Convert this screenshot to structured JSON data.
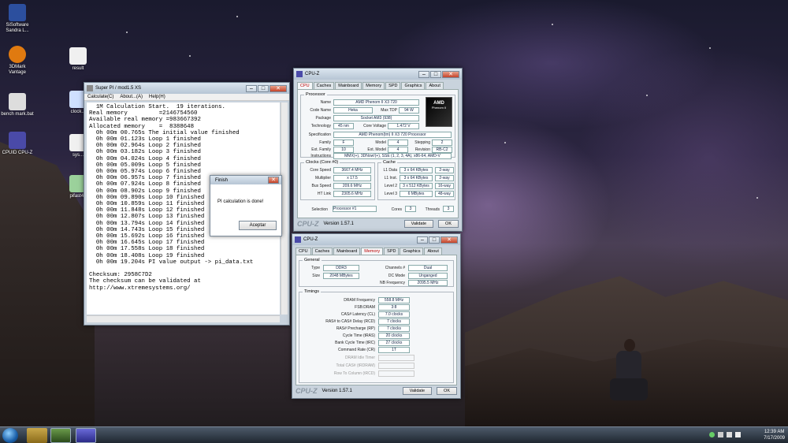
{
  "desktop": {
    "icons": [
      {
        "label": "SiSoftware Sandra L...",
        "color": "#2c4f9e"
      },
      {
        "label": "3DMark Vantage",
        "color": "#e07a10"
      },
      {
        "label": "bench mark.bat",
        "color": "#dddddd"
      },
      {
        "label": "CPUID CPU-Z",
        "color": "#4a4aa8"
      },
      {
        "label": "result",
        "color": "#f0f0f0"
      },
      {
        "label": "clock...",
        "color": "#cfe0ff"
      },
      {
        "label": "sys...",
        "color": "#f0f0f0"
      },
      {
        "label": "pifast41",
        "color": "#9bd19b"
      }
    ]
  },
  "superpi": {
    "title": "Super PI / mod1.5 XS",
    "menu": [
      "Calculate(C)",
      "About...(A)",
      "Help(H)"
    ],
    "console_lines": [
      "  1M Calculation Start.  19 iterations.",
      "Real memory         =2146754560",
      "Available real memory =983667392",
      "Allocated memory    =  8388648",
      "  0h 00m 00.765s The initial value finished",
      "  0h 00m 01.123s Loop 1 finished",
      "  0h 00m 02.964s Loop 2 finished",
      "  0h 00m 03.182s Loop 3 finished",
      "  0h 00m 04.024s Loop 4 finished",
      "  0h 00m 05.009s Loop 5 finished",
      "  0h 00m 05.974s Loop 6 finished",
      "  0h 00m 06.957s Loop 7 finished",
      "  0h 00m 07.924s Loop 8 finished",
      "  0h 00m 08.902s Loop 9 finished",
      "  0h 00m 09.890s Loop 10 finished",
      "  0h 00m 10.859s Loop 11 finished",
      "  0h 00m 11.848s Loop 12 finished",
      "  0h 00m 12.807s Loop 13 finished",
      "  0h 00m 13.794s Loop 14 finished",
      "  0h 00m 14.743s Loop 15 finished",
      "  0h 00m 15.692s Loop 16 finished",
      "  0h 00m 16.645s Loop 17 finished",
      "  0h 00m 17.558s Loop 18 finished",
      "  0h 00m 18.408s Loop 19 finished",
      "  0h 00m 19.204s PI value output -> pi_data.txt",
      "",
      "Checksum: 2958C7D2",
      "The checksum can be validated at",
      "http://www.xtremesystems.org/"
    ]
  },
  "dialog": {
    "title": "Finish",
    "message": "PI calculation is done!",
    "ok_label": "Aceptar"
  },
  "cpuz1": {
    "title": "CPU-Z",
    "tabs": [
      "CPU",
      "Caches",
      "Mainboard",
      "Memory",
      "SPD",
      "Graphics",
      "About"
    ],
    "active_tab": "CPU",
    "processor_group": "Processor",
    "name_label": "Name",
    "name": "AMD Phenom II X3 720",
    "codename_label": "Code Name",
    "codename": "Heka",
    "maxtdp_label": "Max TDP",
    "maxtdp": "94 W",
    "package_label": "Package",
    "package": "Socket AM3 (938)",
    "technology_label": "Technology",
    "technology": "45 nm",
    "corevoltage_label": "Core Voltage",
    "corevoltage": "1.472 V",
    "spec_label": "Specification",
    "spec": "AMD Phenom(tm) II X3 720 Processor",
    "family_label": "Family",
    "family": "F",
    "model_label": "Model",
    "model": "4",
    "stepping_label": "Stepping",
    "stepping": "2",
    "extfamily_label": "Ext. Family",
    "extfamily": "10",
    "extmodel_label": "Ext. Model",
    "extmodel": "4",
    "revision_label": "Revision",
    "revision": "RB-C2",
    "instr_label": "Instructions",
    "instr": "MMX(+), 3DNow!(+), SSE (1, 2, 3, 4A), x86-64, AMD-V",
    "clocks_group": "Clocks (Core #0)",
    "corespeed_label": "Core Speed",
    "corespeed": "3667.4 MHz",
    "multiplier_label": "Multiplier",
    "multiplier": "x 17.5",
    "busspeed_label": "Bus Speed",
    "busspeed": "209.6 MHz",
    "htlink_label": "HT Link",
    "htlink": "2305.6 MHz",
    "cache_group": "Cache",
    "l1d_label": "L1 Data",
    "l1d": "3 x 64 KBytes",
    "l1d_way": "2-way",
    "l1i_label": "L1 Inst.",
    "l1i": "3 x 64 KBytes",
    "l1i_way": "2-way",
    "l2_label": "Level 2",
    "l2": "3 x 512 KBytes",
    "l2_way": "16-way",
    "l3_label": "Level 3",
    "l3": "6 MBytes",
    "l3_way": "48-way",
    "selection_label": "Selection",
    "selection": "Processor #1",
    "cores_label": "Cores",
    "cores": "3",
    "threads_label": "Threads",
    "threads": "3",
    "version": "Version 1.57.1",
    "validate_label": "Validate",
    "ok_label": "OK",
    "logo": "CPU-Z"
  },
  "cpuz2": {
    "title": "CPU-Z",
    "tabs": [
      "CPU",
      "Caches",
      "Mainboard",
      "Memory",
      "SPD",
      "Graphics",
      "About"
    ],
    "active_tab": "Memory",
    "general_group": "General",
    "type_label": "Type",
    "type": "DDR3",
    "channels_label": "Channels #",
    "channels": "Dual",
    "size_label": "Size",
    "size": "2048 MBytes",
    "dcmode_label": "DC Mode",
    "dcmode": "Unganged",
    "nbfreq_label": "NB Frequency",
    "nbfreq": "2095.5 MHz",
    "timings_group": "Timings",
    "dram_label": "DRAM Frequency",
    "dram": "558.8 MHz",
    "fsb_label": "FSB:DRAM",
    "fsb": "3:8",
    "cl_label": "CAS# Latency (CL)",
    "cl": "7.0 clocks",
    "rcd_label": "RAS# to CAS# Delay (RCD)",
    "rcd": "7 clocks",
    "rp_label": "RAS# Precharge (RP)",
    "rp": "7 clocks",
    "tras_label": "Cycle Time (tRAS)",
    "tras": "20 clocks",
    "trc_label": "Bank Cycle Time (tRC)",
    "trc": "27 clocks",
    "cr_label": "Command Rate (CR)",
    "cr": "1T",
    "idle_label": "DRAM Idle Timer",
    "rdram_label": "Total CAS# (tRDRAM)",
    "trcd_label": "Row To Column (tRCD)",
    "version": "Version 1.57.1",
    "validate_label": "Validate",
    "ok_label": "OK",
    "logo": "CPU-Z"
  },
  "taskbar": {
    "time": "12:39 AM",
    "date": "7/17/2009"
  }
}
